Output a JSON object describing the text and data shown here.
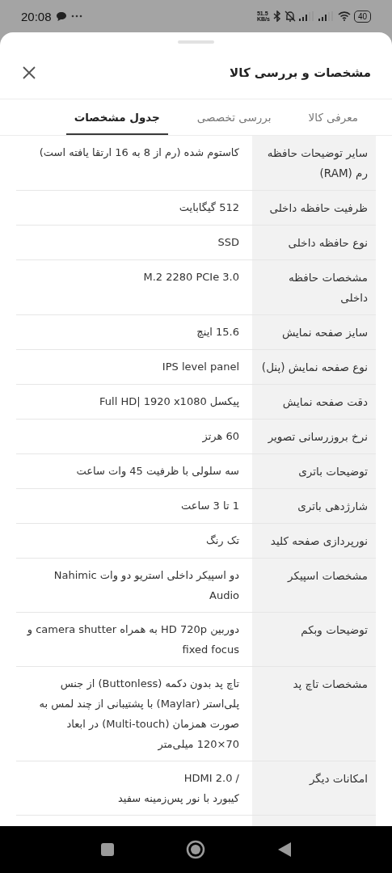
{
  "status_bar": {
    "time": "20:08",
    "net_speed": "51.5",
    "net_unit": "KB/s",
    "battery": "40"
  },
  "sheet": {
    "title": "مشخصات و بررسی کالا"
  },
  "tabs": [
    {
      "label": "معرفی کالا",
      "selected": false
    },
    {
      "label": "بررسی تخصصی",
      "selected": false
    },
    {
      "label": "جدول مشخصات",
      "selected": true
    }
  ],
  "specs": [
    {
      "label": "سایر توضیحات حافظه رم (RAM)",
      "value": "کاستوم شده (رم از 8 به 16 ارتقا یافته است)"
    },
    {
      "label": "ظرفیت حافظه داخلی",
      "value": "512 گیگابایت"
    },
    {
      "label": "نوع حافظه داخلی",
      "value": "SSD"
    },
    {
      "label": "مشخصات حافظه داخلی",
      "value": "M.2 2280 PCIe 3.0"
    },
    {
      "label": "سایز صفحه نمایش",
      "value": "15.6 اینچ"
    },
    {
      "label": "نوع صفحه نمایش (پنل)",
      "value": "IPS level panel"
    },
    {
      "label": "دقت صفحه نمایش",
      "value": "پیکسل Full HD| 1920 x1080"
    },
    {
      "label": "نرخ بروزرسانی تصویر",
      "value": "60 هرتز"
    },
    {
      "label": "توضیحات باتری",
      "value": "سه سلولی با ظرفیت 45 وات ساعت"
    },
    {
      "label": "شارژدهی باتری",
      "value": "1 تا 3 ساعت"
    },
    {
      "label": "نورپردازی صفحه کلید",
      "value": "تک رنگ"
    },
    {
      "label": "مشخصات اسپیکر",
      "value": "دو اسپیکر داخلی استریو دو وات Nahimic Audio"
    },
    {
      "label": "توضیحات وبکم",
      "value": "دوربین HD 720p به همراه camera shutter و fixed focus"
    },
    {
      "label": "مشخصات تاچ پد",
      "value": "تاچ پد بدون دکمه (Buttonless) از جنس پلی‌استر (Maylar) با پشتیبانی از چند لمس به صورت همزمان (Multi-touch) در ابعاد 70×120 میلی‌متر"
    },
    {
      "label": "امکانات دیگر",
      "value": "/ HDMI 2.0\nکیبورد با نور پس‌زمینه سفید"
    }
  ]
}
